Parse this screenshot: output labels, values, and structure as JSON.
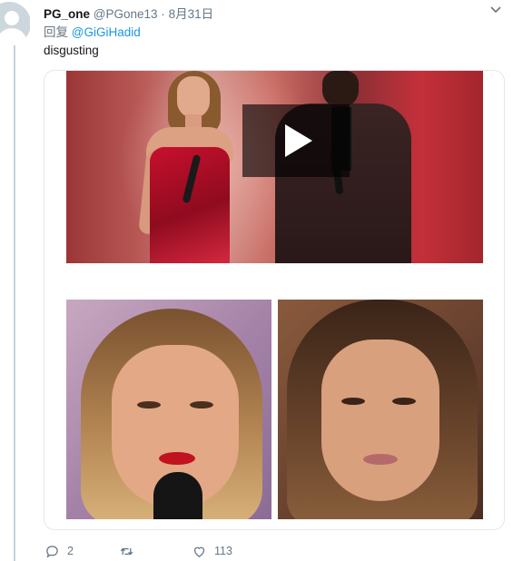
{
  "tweet": {
    "display_name": "PG_one",
    "handle": "@PGone13",
    "separator": "·",
    "date": "8月31日",
    "reply_prefix": "回复",
    "reply_to": "@GiGiHadid",
    "text": "disgusting"
  },
  "actions": {
    "reply_count": "2",
    "retweet_count": "",
    "like_count": "113"
  },
  "icons": [
    "default-avatar-icon",
    "chevron-down-icon",
    "play-icon",
    "reply-icon",
    "retweet-icon",
    "heart-icon"
  ],
  "colors": {
    "link": "#1b95e0",
    "secondary_text": "#657786",
    "thread_line": "#c7d3dc",
    "card_border": "#e1e8ed"
  }
}
